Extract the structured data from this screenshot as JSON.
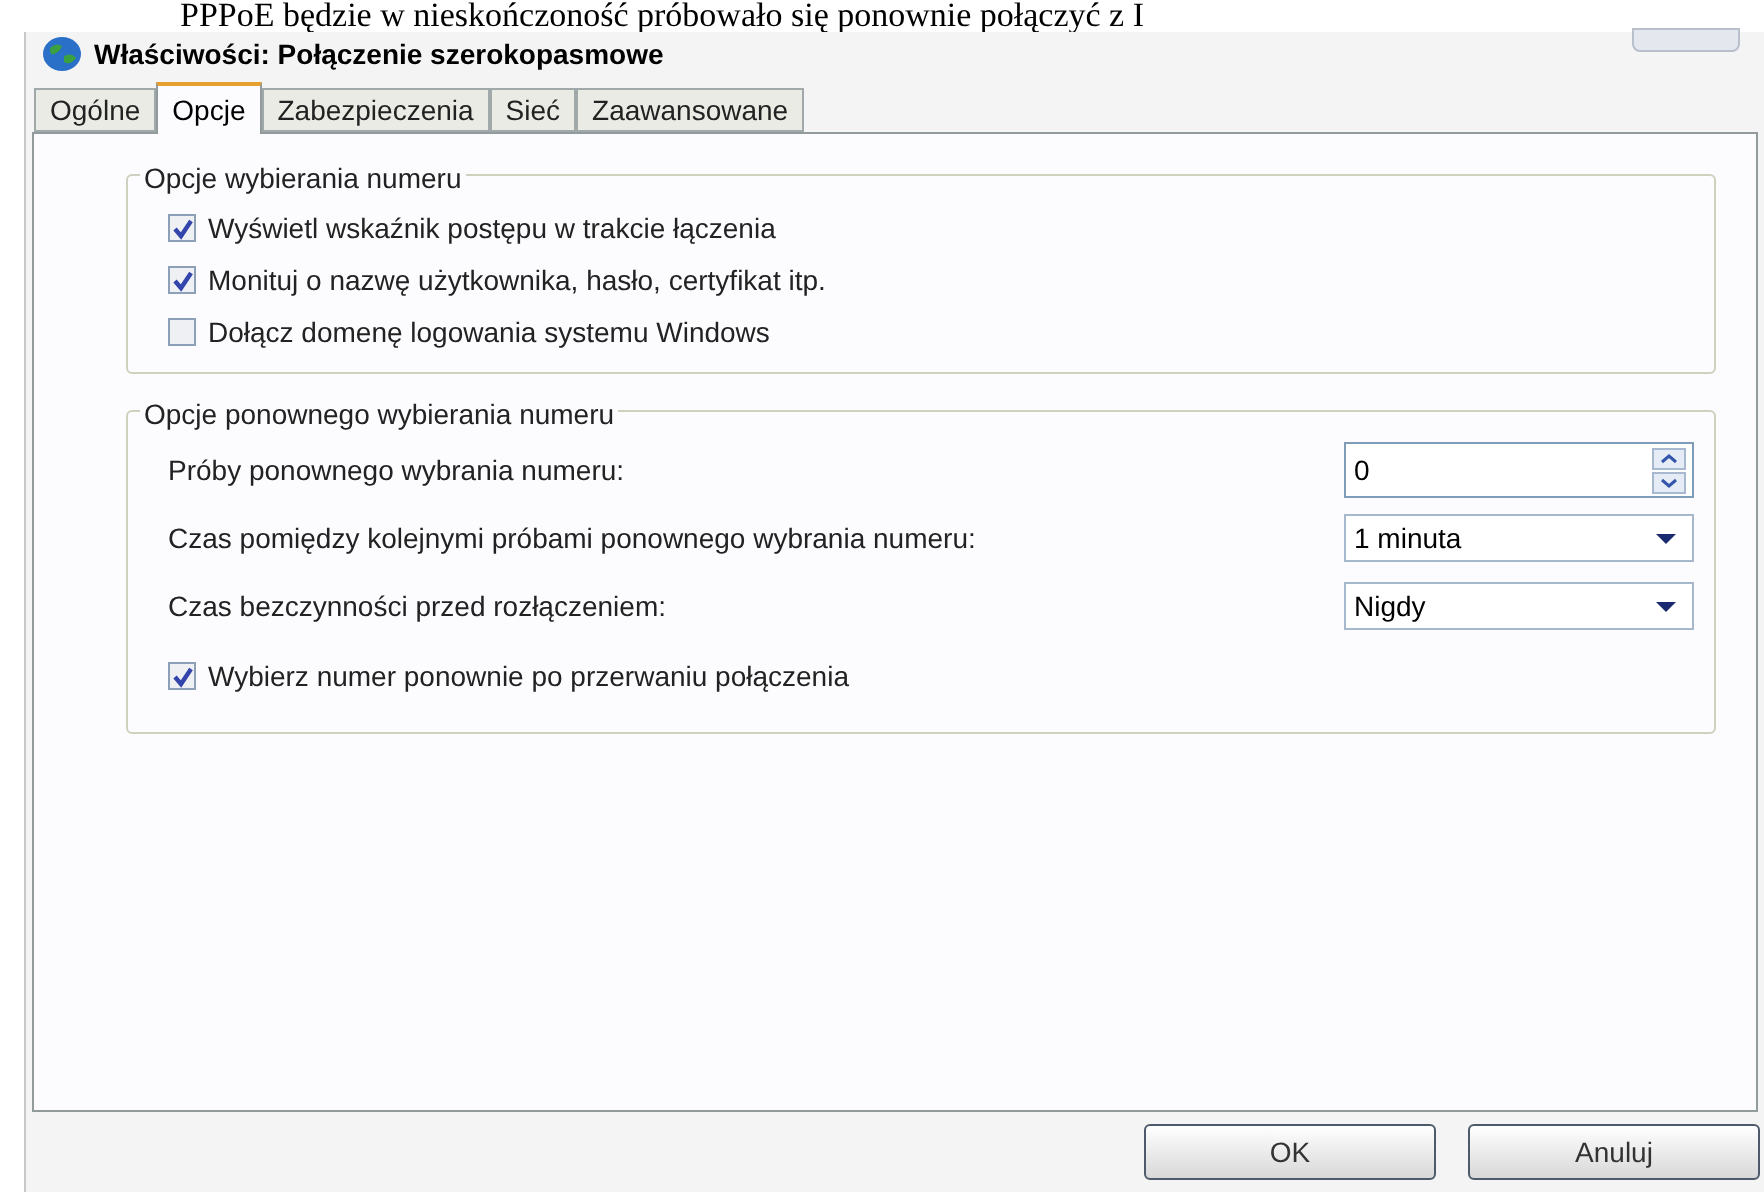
{
  "background_text": "PPPoE będzie w nieskończoność próbowało się ponownie połączyć z I",
  "window": {
    "title": "Właściwości: Połączenie szerokopasmowe"
  },
  "tabs": [
    {
      "label": "Ogólne",
      "selected": false
    },
    {
      "label": "Opcje",
      "selected": true
    },
    {
      "label": "Zabezpieczenia",
      "selected": false
    },
    {
      "label": "Sieć",
      "selected": false
    },
    {
      "label": "Zaawansowane",
      "selected": false
    }
  ],
  "dialing_options": {
    "title": "Opcje wybierania numeru",
    "checkboxes": [
      {
        "label": "Wyświetl wskaźnik postępu w trakcie łączenia",
        "checked": true
      },
      {
        "label": "Monituj o nazwę użytkownika, hasło, certyfikat itp.",
        "checked": true
      },
      {
        "label": "Dołącz domenę logowania systemu Windows",
        "checked": false
      }
    ]
  },
  "redial_options": {
    "title": "Opcje ponownego wybierania numeru",
    "fields": [
      {
        "kind": "spinner",
        "label": "Próby ponownego wybrania numeru:",
        "value": "0"
      },
      {
        "kind": "dropdown",
        "label": "Czas pomiędzy kolejnymi próbami ponownego wybrania numeru:",
        "value": "1 minuta"
      },
      {
        "kind": "dropdown",
        "label": "Czas bezczynności przed rozłączeniem:",
        "value": "Nigdy"
      }
    ],
    "checkbox": {
      "label": "Wybierz numer ponownie po przerwaniu połączenia",
      "checked": true
    }
  },
  "buttons": [
    "OK",
    "Anuluj"
  ]
}
